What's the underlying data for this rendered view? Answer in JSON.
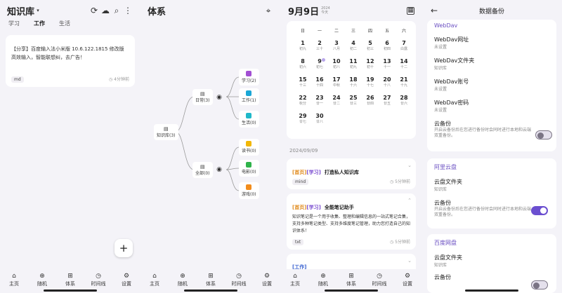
{
  "s1": {
    "title": "知识库",
    "tabs": [
      "学习",
      "工作",
      "生活"
    ],
    "active_tab": "工作",
    "note": {
      "text": "【分享】百度输入法小米版 10.6.122.1815 修改版 高效输入，智能联想纠，去广告！",
      "tag": "md",
      "time": "4分钟前"
    }
  },
  "s2": {
    "title": "体系",
    "root": "知识库(3)",
    "branches": [
      {
        "label": "日常(3)",
        "children": [
          "学习(2)",
          "工作(1)",
          "生活(0)"
        ]
      },
      {
        "label": "全部(0)",
        "children": [
          "读书(0)",
          "电影(0)",
          "游戏(0)"
        ]
      }
    ]
  },
  "s3": {
    "date": "9月9日",
    "year": "2024",
    "weekday": "今天",
    "weekday_headers": [
      "日",
      "一",
      "二",
      "三",
      "四",
      "五",
      "六"
    ],
    "cal_days": [
      {
        "d": "1",
        "l": "初九"
      },
      {
        "d": "2",
        "l": "三十"
      },
      {
        "d": "3",
        "l": "八月"
      },
      {
        "d": "4",
        "l": "初二"
      },
      {
        "d": "5",
        "l": "初三"
      },
      {
        "d": "6",
        "l": "初四"
      },
      {
        "d": "7",
        "l": "白露"
      },
      {
        "d": "8",
        "l": "初六"
      },
      {
        "d": "9",
        "l": "初七"
      },
      {
        "d": "10",
        "l": "初八"
      },
      {
        "d": "11",
        "l": "初九"
      },
      {
        "d": "12",
        "l": "初十"
      },
      {
        "d": "13",
        "l": "十一"
      },
      {
        "d": "14",
        "l": "十二"
      },
      {
        "d": "15",
        "l": "十三"
      },
      {
        "d": "16",
        "l": "十四"
      },
      {
        "d": "17",
        "l": "中秋"
      },
      {
        "d": "18",
        "l": "十六"
      },
      {
        "d": "19",
        "l": "十七"
      },
      {
        "d": "20",
        "l": "十八"
      },
      {
        "d": "21",
        "l": "十九"
      },
      {
        "d": "22",
        "l": "秋分"
      },
      {
        "d": "23",
        "l": "廿一"
      },
      {
        "d": "24",
        "l": "廿二"
      },
      {
        "d": "25",
        "l": "廿三"
      },
      {
        "d": "26",
        "l": "廿四"
      },
      {
        "d": "27",
        "l": "廿五"
      },
      {
        "d": "28",
        "l": "廿六"
      },
      {
        "d": "29",
        "l": "廿七"
      },
      {
        "d": "30",
        "l": "廿八"
      }
    ],
    "day_label": "2024/09/09",
    "notes": [
      {
        "cat": "[首页]",
        "sub": "[学习]",
        "title": "打造私人知识库",
        "tag": "mind",
        "time": "5分钟前"
      },
      {
        "cat": "[首页]",
        "sub": "[学习]",
        "title": "全能笔记助手",
        "body": "知识笔记是一个用于收集、整理和编辑信息的一站式笔记合集，支持多种笔记类型、支持多维度笔记管理，助力您打造自己的知识体系！",
        "tag": "txt",
        "time": "5分钟前"
      },
      {
        "cat": "[工作]",
        "sub": "",
        "title": ""
      }
    ]
  },
  "s4": {
    "title": "数据备份",
    "sections": [
      {
        "title": "WebDav",
        "rows": [
          {
            "t": "WebDav网址",
            "s": "未设置"
          },
          {
            "t": "WebDav文件夹",
            "s": "知识库"
          },
          {
            "t": "WebDav账号",
            "s": "未设置"
          },
          {
            "t": "WebDav密码",
            "s": "未设置"
          },
          {
            "t": "云备份",
            "s": "开启云备份后在您进行备份时会同时进行本地和云端双重备份。",
            "toggle": "off"
          }
        ]
      },
      {
        "title": "阿里云盘",
        "rows": [
          {
            "t": "云盘文件夹",
            "s": "知识库"
          },
          {
            "t": "云备份",
            "s": "开启云备份后在您进行备份时会同时进行本地和云端双重备份。",
            "toggle": "on"
          }
        ]
      },
      {
        "title": "百度网盘",
        "rows": [
          {
            "t": "云盘文件夹",
            "s": "知识库"
          },
          {
            "t": "云备份",
            "s": "",
            "toggle": "off"
          }
        ]
      }
    ]
  },
  "nav": [
    "主页",
    "随机",
    "体系",
    "时间线",
    "设置"
  ],
  "nav_icons": [
    "home-icon",
    "shuffle-icon",
    "tree-icon",
    "clock-icon",
    "gear-icon"
  ],
  "colors": {
    "accent": "#6b4fd0",
    "orange": "#e08a1c",
    "purple": "#7a4dd0"
  },
  "node_colors": [
    "#a24fd3",
    "#1aa7d6",
    "#1fb8c9",
    "#f2b705",
    "#2fb34a",
    "#f28c1c"
  ]
}
